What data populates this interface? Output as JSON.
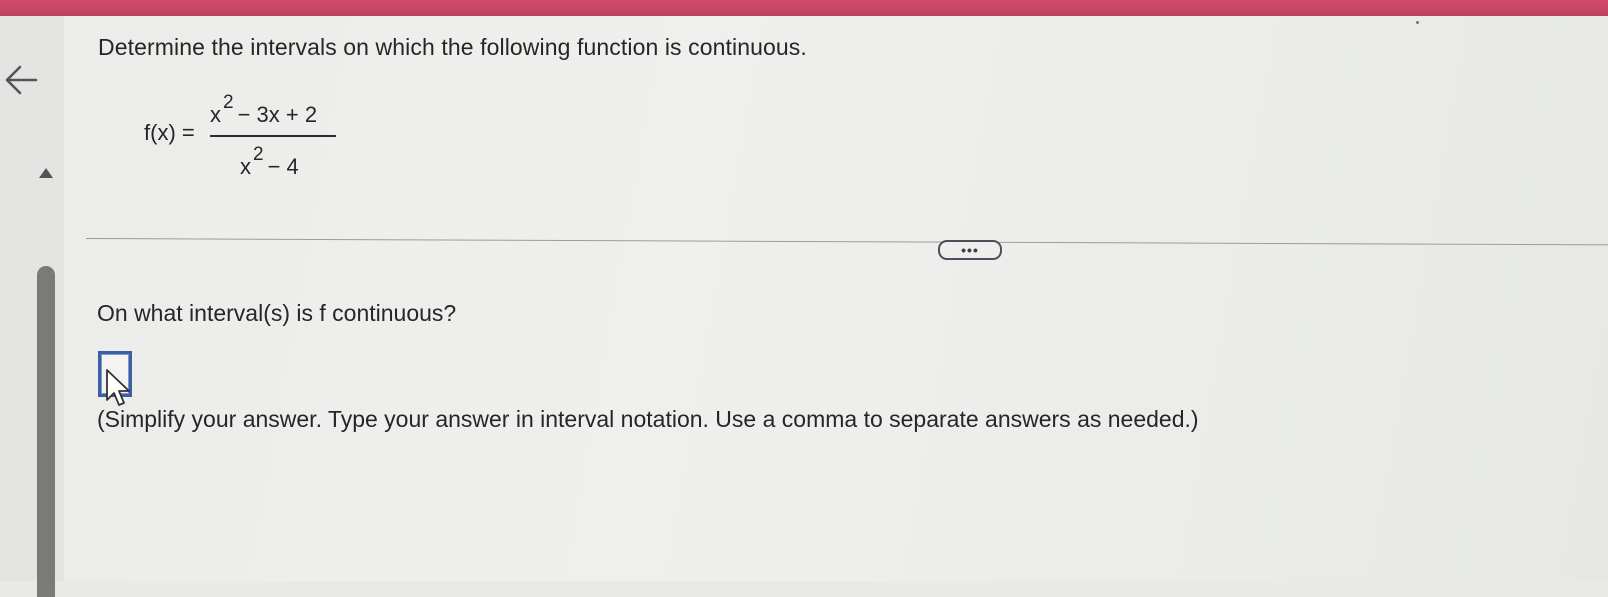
{
  "header": {
    "accent_color": "#c84466"
  },
  "nav": {
    "back_icon": "arrow-left-icon",
    "collapse_icon": "triangle-up-icon"
  },
  "question": {
    "prompt": "Determine the intervals on which the following function is continuous.",
    "function_label": "f(x) =",
    "numerator_base": "x",
    "numerator_exp": "2",
    "numerator_rest": "− 3x + 2",
    "denominator_base": "x",
    "denominator_exp": "2",
    "denominator_rest": "− 4"
  },
  "more_button": {
    "label": "•••"
  },
  "part": {
    "question": "On what interval(s) is f continuous?",
    "answer_value": "",
    "instructions": "(Simplify your answer. Type your answer in interval notation. Use a comma to separate answers as needed.)"
  },
  "colors": {
    "answer_box_border": "#3c5ea5",
    "scrollbar": "#7a7a78"
  }
}
